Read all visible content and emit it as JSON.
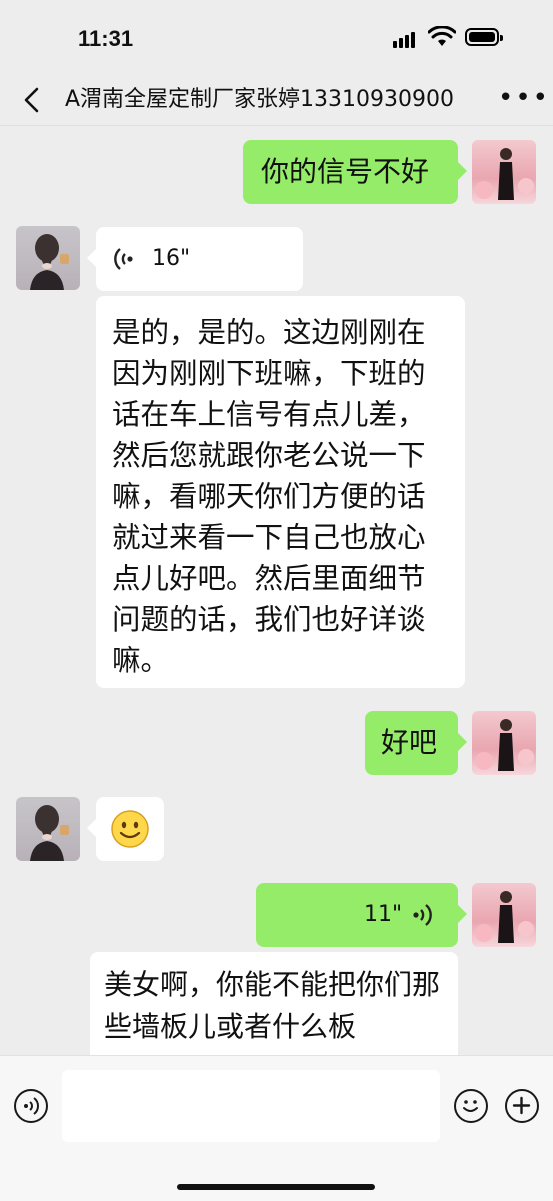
{
  "status": {
    "time": "11:31"
  },
  "chat": {
    "title": "A渭南全屋定制厂家张婷13310930900"
  },
  "messages": [
    {
      "side": "right",
      "type": "text",
      "text": "你的信号不好"
    },
    {
      "side": "left",
      "type": "voice",
      "duration": "16\""
    },
    {
      "side": "left",
      "type": "text",
      "text": "是的，是的。这边刚刚在因为刚刚下班嘛，下班的话在车上信号有点儿差，然后您就跟你老公说一下嘛，看哪天你们方便的话就过来看一下自己也放心点儿好吧。然后里面细节问题的话，我们也好详谈嘛。"
    },
    {
      "side": "right",
      "type": "text",
      "text": "好吧"
    },
    {
      "side": "left",
      "type": "emoji",
      "emoji": "smile"
    },
    {
      "side": "right",
      "type": "voice",
      "duration": "11\""
    },
    {
      "side": "right",
      "type": "text",
      "text": "美女啊，你能不能把你们那些墙板儿或者什么板"
    }
  ],
  "colors": {
    "self_bubble": "#95ec69",
    "other_bubble": "#ffffff",
    "background": "#ededed"
  }
}
